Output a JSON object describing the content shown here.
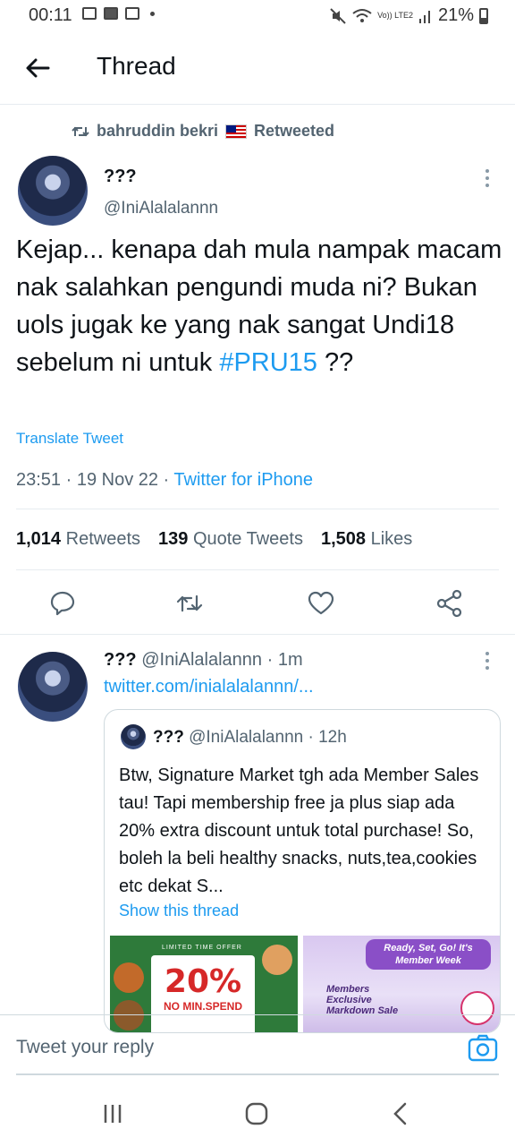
{
  "status_bar": {
    "time": "00:11",
    "lte": "Vo)) LTE2",
    "battery": "21%"
  },
  "header": {
    "title": "Thread"
  },
  "retweet": {
    "retweeter": "bahruddin bekri",
    "label": "Retweeted"
  },
  "tweet": {
    "author_name": "???",
    "handle": "@IniAlalalannn",
    "text_main": "Kejap... kenapa dah mula nampak macam nak salahkan pengundi muda ni? Bukan uols jugak ke yang nak sangat Undi18 sebelum ni untuk",
    "hashtag": "#PRU15",
    "text_tail": "??",
    "translate": "Translate Tweet",
    "time": "23:51 · 19 Nov 22 ·",
    "client": "Twitter for iPhone",
    "stats": {
      "retweets_count": "1,014",
      "retweets_label": "Retweets",
      "quotes_count": "139",
      "quotes_label": "Quote Tweets",
      "likes_count": "1,508",
      "likes_label": "Likes"
    }
  },
  "reply": {
    "author_name": "???",
    "handle_time": "@IniAlalalannn · 1m",
    "link": "twitter.com/inialalalannn/...",
    "quote": {
      "author_name": "???",
      "handle_time": "@IniAlalalannn · 12h",
      "text": "Btw, Signature Market tgh ada Member Sales tau! Tapi membership free ja plus siap ada 20% extra discount untuk total purchase! So, boleh la beli healthy snacks, nuts,tea,cookies etc dekat S...",
      "show_thread": "Show this thread",
      "image1": {
        "header": "LIMITED TIME OFFER",
        "percent": "20%",
        "min_spend": "NO MIN.SPEND"
      },
      "image2": {
        "banner": "Ready, Set, Go! It's Member Week",
        "subtitle": "Members Exclusive Markdown Sale"
      }
    }
  },
  "composer": {
    "placeholder": "Tweet your reply"
  },
  "colors": {
    "accent": "#1d9bf0",
    "secondary_text": "#536471"
  }
}
